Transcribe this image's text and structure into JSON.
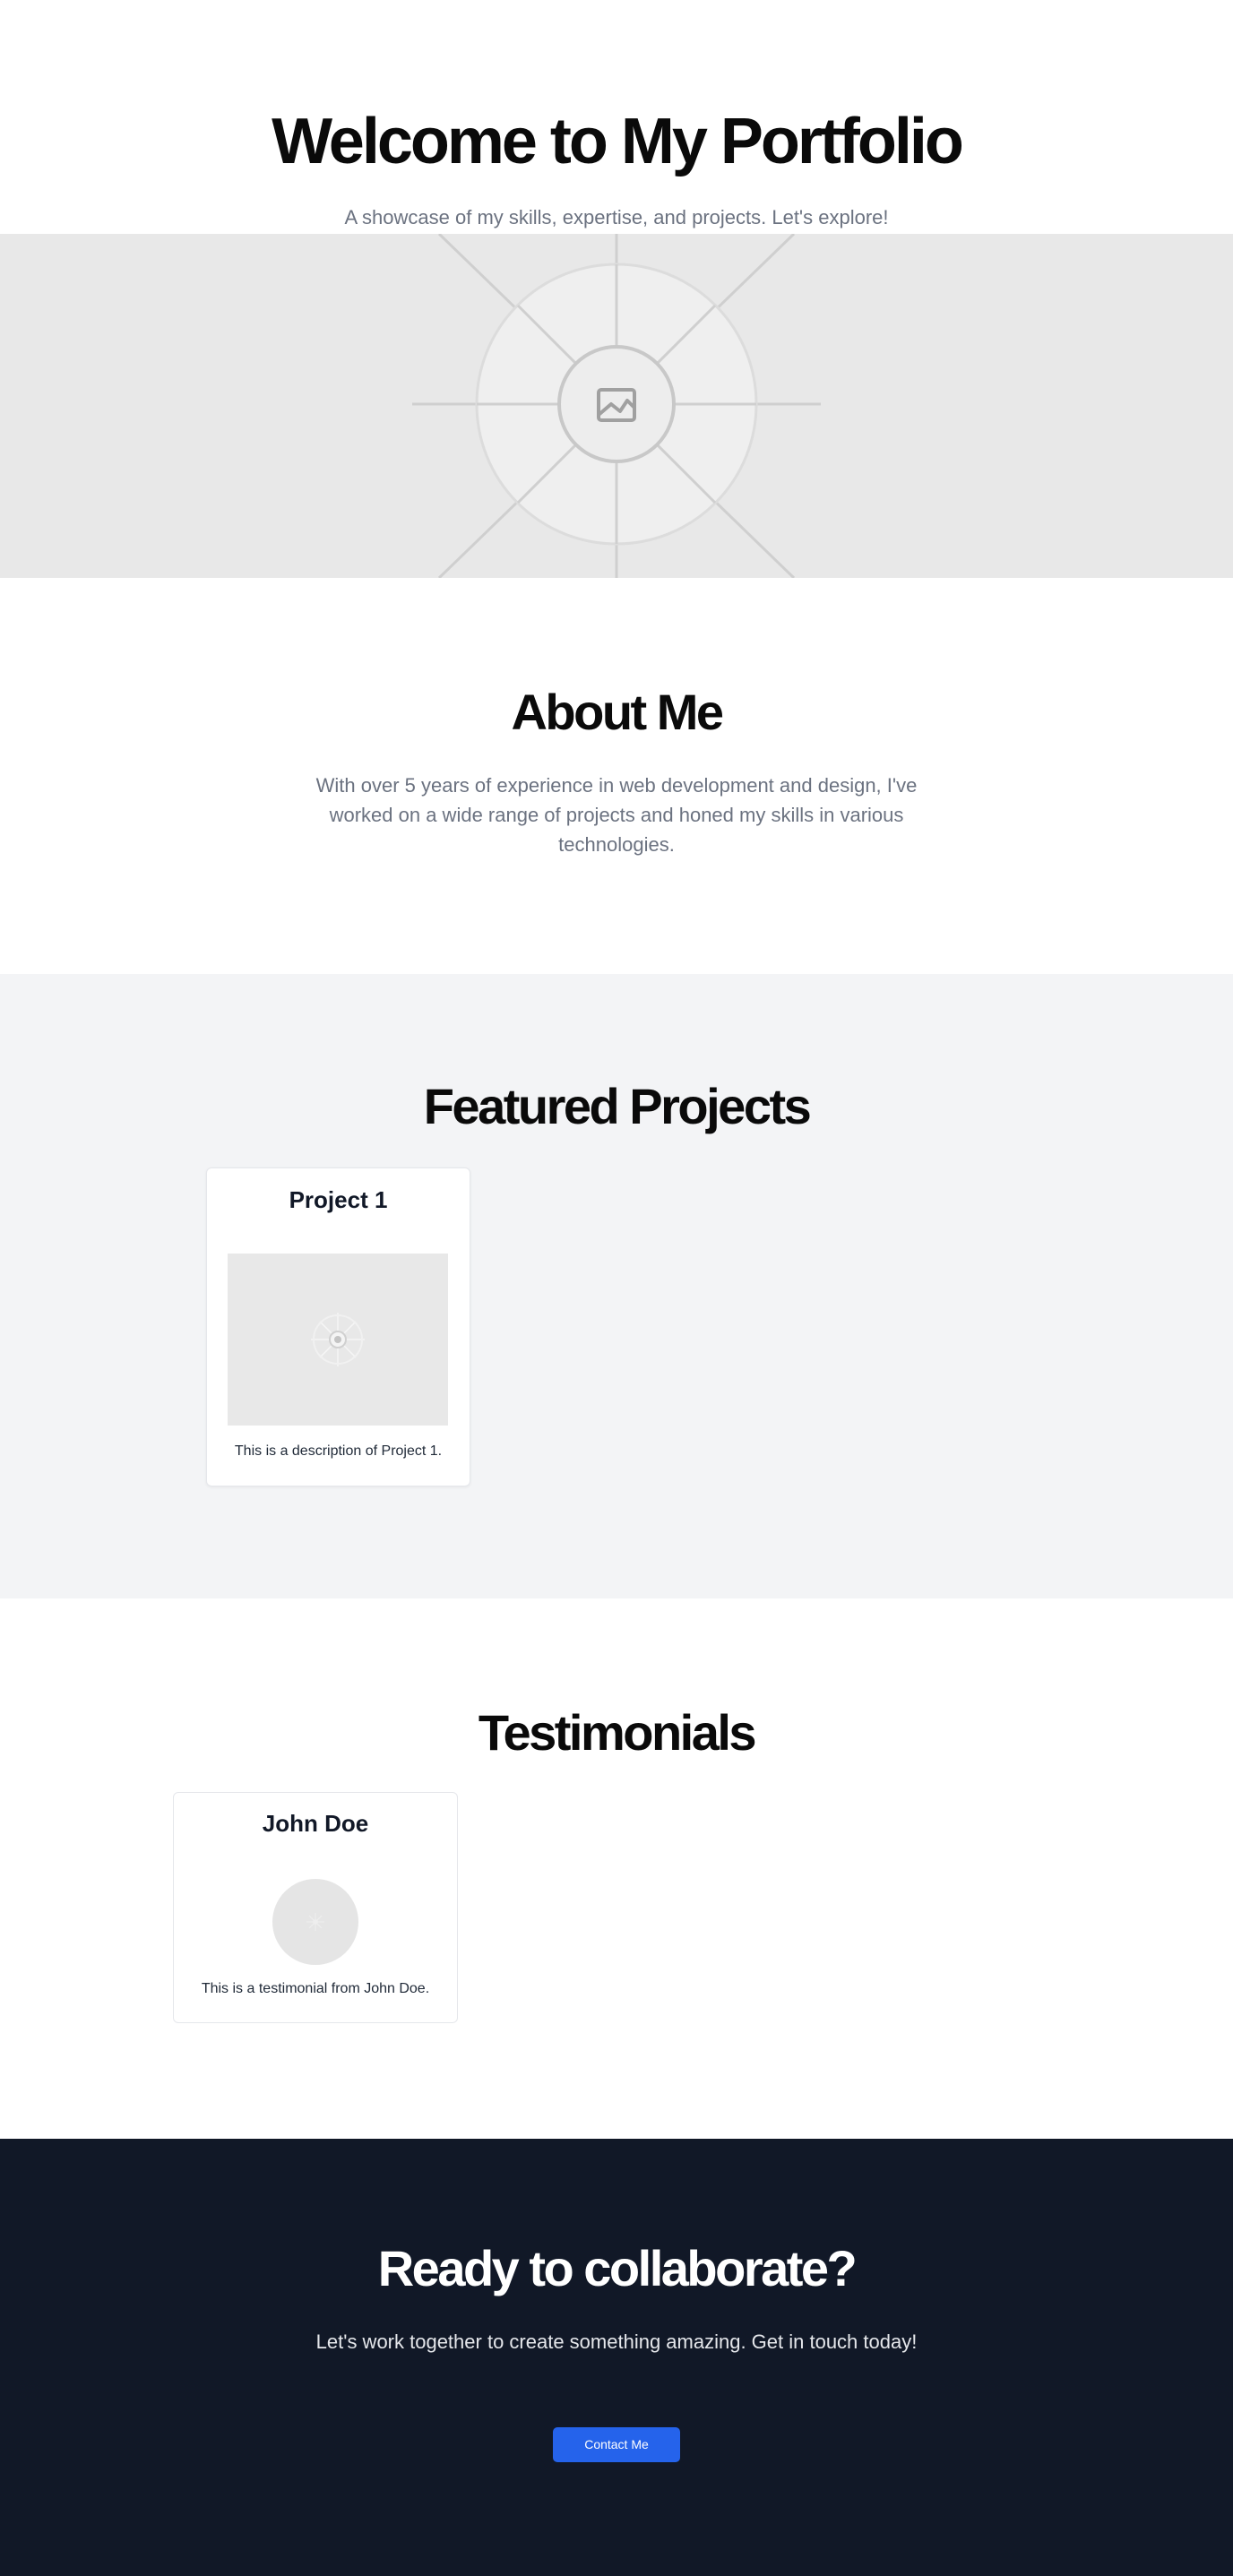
{
  "hero": {
    "title": "Welcome to My Portfolio",
    "subtitle": "A showcase of my skills, expertise, and projects. Let's explore!",
    "image_icon": "image-placeholder-icon"
  },
  "about": {
    "title": "About Me",
    "text": "With over 5 years of experience in web development and design, I've worked on a wide range of projects and honed my skills in various technologies."
  },
  "projects": {
    "title": "Featured Projects",
    "items": [
      {
        "title": "Project 1",
        "description": "This is a description of Project 1.",
        "image_icon": "image-placeholder-icon"
      }
    ]
  },
  "testimonials": {
    "title": "Testimonials",
    "items": [
      {
        "name": "John Doe",
        "text": "This is a testimonial from John Doe.",
        "avatar_icon": "avatar-placeholder-icon"
      }
    ]
  },
  "cta": {
    "title": "Ready to collaborate?",
    "text": "Let's work together to create something amazing. Get in touch today!",
    "button_label": "Contact Me"
  },
  "colors": {
    "accent": "#2563eb",
    "dark_section": "#111827",
    "muted_text": "#6b7280",
    "light_section": "#f3f4f6",
    "placeholder": "#e8e8e8"
  }
}
